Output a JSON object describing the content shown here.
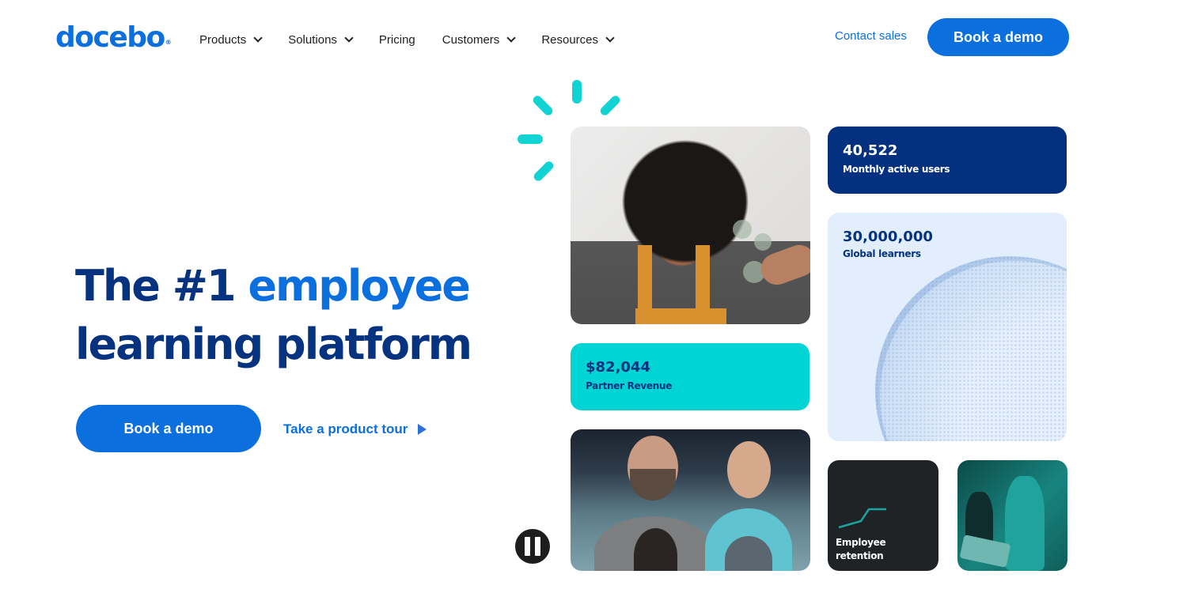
{
  "brand": {
    "name": "docebo",
    "mark": "®"
  },
  "nav": {
    "items": [
      {
        "label": "Products",
        "has_dropdown": true
      },
      {
        "label": "Solutions",
        "has_dropdown": true
      },
      {
        "label": "Pricing",
        "has_dropdown": false
      },
      {
        "label": "Customers",
        "has_dropdown": true
      },
      {
        "label": "Resources",
        "has_dropdown": true
      }
    ],
    "contact_label": "Contact sales",
    "cta_label": "Book a demo"
  },
  "hero": {
    "headline_part1": "The #1 ",
    "headline_accent": "employee",
    "headline_part2": "learning platform",
    "primary_cta": "Book a demo",
    "secondary_cta": "Take a product tour",
    "secondary_icon": "play-triangle-icon"
  },
  "stats": {
    "monthly_users": {
      "value": "40,522",
      "label": "Monthly active users"
    },
    "global_learners": {
      "value": "30,000,000",
      "label": "Global learners"
    },
    "partner_revenue": {
      "value": "$82,044",
      "label": "Partner Revenue"
    },
    "retention": {
      "label_line1": "Employee",
      "label_line2": "retention"
    }
  },
  "media": {
    "pause_icon": "pause-icon"
  },
  "colors": {
    "brand_blue": "#0b6fde",
    "navy": "#03307f",
    "teal": "#00d4d4",
    "light_blue": "#e2eefc",
    "dark_card": "#1f2326"
  }
}
